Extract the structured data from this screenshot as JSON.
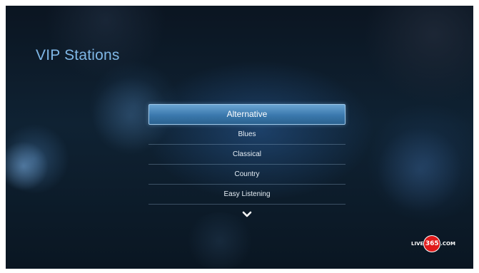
{
  "page": {
    "title": "VIP Stations"
  },
  "stations": [
    {
      "label": "Alternative",
      "selected": true
    },
    {
      "label": "Blues",
      "selected": false
    },
    {
      "label": "Classical",
      "selected": false
    },
    {
      "label": "Country",
      "selected": false
    },
    {
      "label": "Easy Listening",
      "selected": false
    }
  ],
  "more_indicator": {
    "icon": "chevron-down-icon"
  },
  "brand": {
    "prefix": "LIVE",
    "number": "365",
    "suffix": ".COM",
    "logo_color": "#e01a1a"
  },
  "colors": {
    "title": "#7fb7e6",
    "selection": "#3a78ad",
    "background": "#0f2233"
  }
}
